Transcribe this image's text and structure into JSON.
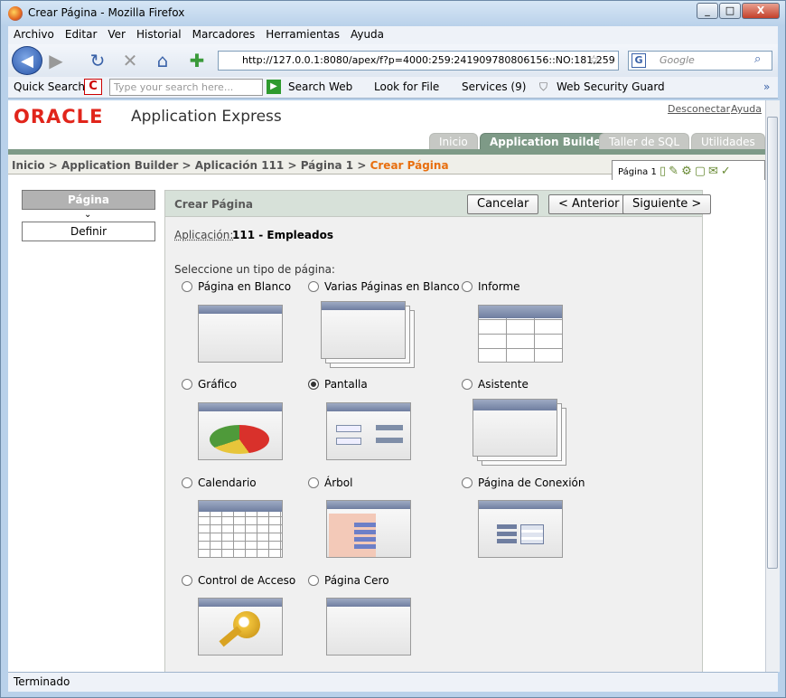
{
  "window": {
    "title": "Crear Página - Mozilla Firefox",
    "min": "_",
    "max": "□",
    "close": "X"
  },
  "menu": [
    "Archivo",
    "Editar",
    "Ver",
    "Historial",
    "Marcadores",
    "Herramientas",
    "Ayuda"
  ],
  "nav": {
    "url": "http://127.0.0.1:8080/apex/f?p=4000:259:241909780806156::NO:181,259",
    "search_placeholder": "Google"
  },
  "quickbar": {
    "label": "Quick Search:",
    "placeholder": "Type your search here...",
    "search_web": "Search Web",
    "look_for_file": "Look for File",
    "services": "Services (9)",
    "security": "Web Security Guard"
  },
  "header": {
    "logo": "ORACLE",
    "product": "Application Express",
    "logout": "Desconectar",
    "help": "Ayuda"
  },
  "tabs": [
    "Inicio",
    "Application Builder",
    "Taller de SQL",
    "Utilidades"
  ],
  "breadcrumb": {
    "items": [
      "Inicio",
      "Application Builder",
      "Aplicación 111",
      "Página 1"
    ],
    "current": "Crear Página",
    "page_box": "Página 1"
  },
  "steps": {
    "current": "Página",
    "next": "Definir"
  },
  "region": {
    "title": "Crear Página",
    "cancel": "Cancelar",
    "prev": "< Anterior",
    "next": "Siguiente >",
    "app_label": "Aplicación:",
    "app_value": "111 - Empleados",
    "prompt": "Seleccione un tipo de página:"
  },
  "options": [
    "Página en Blanco",
    "Varias Páginas en Blanco",
    "Informe",
    "Gráfico",
    "Pantalla",
    "Asistente",
    "Calendario",
    "Árbol",
    "Página de Conexión",
    "Control de Acceso",
    "Página Cero"
  ],
  "selected_option": "Pantalla",
  "status": "Terminado"
}
